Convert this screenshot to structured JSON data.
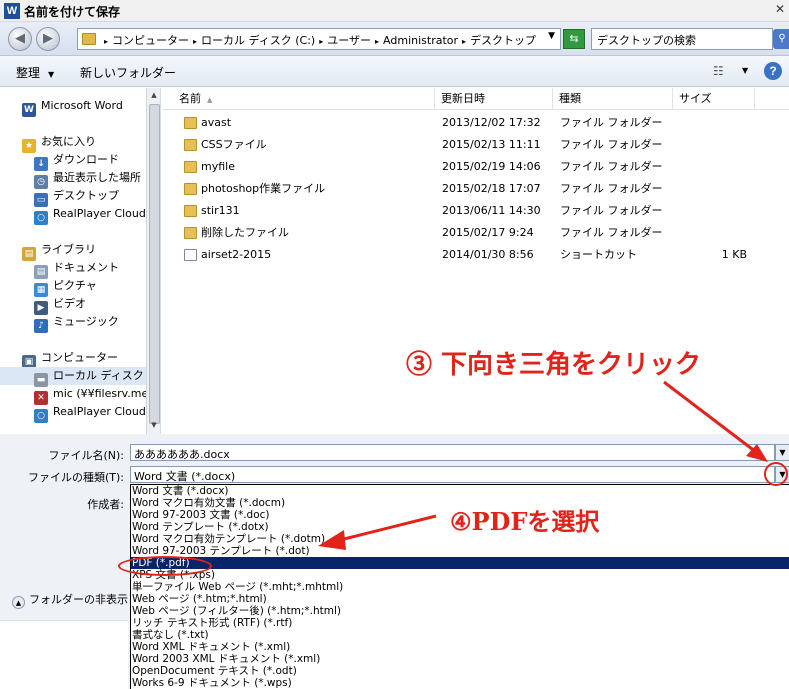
{
  "window": {
    "title": "名前を付けて保存",
    "app_icon_letter": "W"
  },
  "address": {
    "breadcrumbs": [
      "コンピューター",
      "ローカル ディスク (C:)",
      "ユーザー",
      "Administrator",
      "デスクトップ"
    ],
    "search_placeholder": "デスクトップの検索"
  },
  "toolbar": {
    "organize": "整理",
    "new_folder": "新しいフォルダー"
  },
  "nav": {
    "items": [
      {
        "label": "Microsoft Word",
        "icon": "word-icon"
      },
      {
        "label": "お気に入り",
        "icon": "star-icon"
      },
      {
        "label": "ダウンロード",
        "icon": "download-icon"
      },
      {
        "label": "最近表示した場所",
        "icon": "recent-places-icon"
      },
      {
        "label": "デスクトップ",
        "icon": "desktop-icon"
      },
      {
        "label": "RealPlayer Cloud",
        "icon": "realplayer-icon"
      },
      {
        "label": "ライブラリ",
        "icon": "library-icon"
      },
      {
        "label": "ドキュメント",
        "icon": "document-icon"
      },
      {
        "label": "ピクチャ",
        "icon": "picture-icon"
      },
      {
        "label": "ビデオ",
        "icon": "video-icon"
      },
      {
        "label": "ミュージック",
        "icon": "music-icon"
      },
      {
        "label": "コンピューター",
        "icon": "computer-icon"
      },
      {
        "label": "ローカル ディスク (C",
        "icon": "disk-icon"
      },
      {
        "label": "mic (¥¥filesrv.mec",
        "icon": "network-drive-icon"
      },
      {
        "label": "RealPlayer Cloud",
        "icon": "realplayer-icon"
      }
    ]
  },
  "columns": {
    "name": "名前",
    "modified": "更新日時",
    "type": "種類",
    "size": "サイズ"
  },
  "files": [
    {
      "name": "avast",
      "modified": "2013/12/02 17:32",
      "type": "ファイル フォルダー",
      "size": ""
    },
    {
      "name": "CSSファイル",
      "modified": "2015/02/13 11:11",
      "type": "ファイル フォルダー",
      "size": ""
    },
    {
      "name": "myfile",
      "modified": "2015/02/19 14:06",
      "type": "ファイル フォルダー",
      "size": ""
    },
    {
      "name": "photoshop作業ファイル",
      "modified": "2015/02/18 17:07",
      "type": "ファイル フォルダー",
      "size": ""
    },
    {
      "name": "stir131",
      "modified": "2013/06/11 14:30",
      "type": "ファイル フォルダー",
      "size": ""
    },
    {
      "name": "削除したファイル",
      "modified": "2015/02/17 9:24",
      "type": "ファイル フォルダー",
      "size": ""
    },
    {
      "name": "airset2-2015",
      "modified": "2014/01/30 8:56",
      "type": "ショートカット",
      "size": "1 KB"
    }
  ],
  "form": {
    "filename_label": "ファイル名(N):",
    "filename_value": "ああああああ.docx",
    "filetype_label": "ファイルの種類(T):",
    "filetype_value": "Word 文書 (*.docx)",
    "author_label": "作成者:",
    "hide_folders": "フォルダーの非表示"
  },
  "filetype_options": [
    "Word 文書 (*.docx)",
    "Word マクロ有効文書 (*.docm)",
    "Word 97-2003 文書 (*.doc)",
    "Word テンプレート (*.dotx)",
    "Word マクロ有効テンプレート (*.dotm)",
    "Word 97-2003 テンプレート (*.dot)",
    "PDF (*.pdf)",
    "XPS 文書 (*.xps)",
    "単一ファイル Web ページ (*.mht;*.mhtml)",
    "Web ページ (*.htm;*.html)",
    "Web ページ (フィルター後) (*.htm;*.html)",
    "リッチ テキスト形式 (RTF) (*.rtf)",
    "書式なし (*.txt)",
    "Word XML ドキュメント (*.xml)",
    "Word 2003 XML ドキュメント (*.xml)",
    "OpenDocument テキスト (*.odt)",
    "Works 6-9 ドキュメント (*.wps)"
  ],
  "selected_option_index": 6,
  "annotations": {
    "step3": "③ 下向き三角をクリック",
    "step4": "④PDFを選択"
  },
  "colors": {
    "annotation_red": "#e2231a",
    "selection_navy": "#0a246a"
  }
}
